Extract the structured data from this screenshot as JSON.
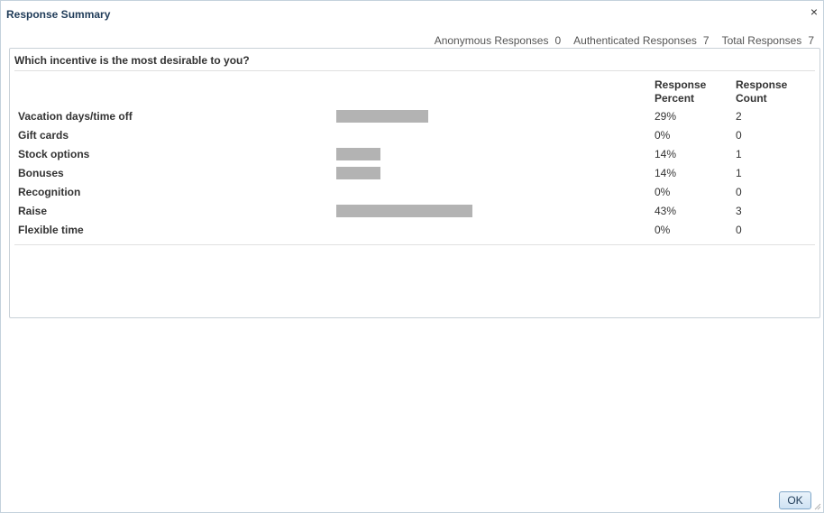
{
  "dialog": {
    "title": "Response Summary",
    "close_glyph": "×",
    "ok_label": "OK",
    "accent_color": "#1f3b58",
    "bar_color": "#b3b3b3"
  },
  "totals": {
    "anonymous_label": "Anonymous Responses",
    "anonymous_value": "0",
    "authenticated_label": "Authenticated Responses",
    "authenticated_value": "7",
    "total_label": "Total Responses",
    "total_value": "7"
  },
  "question": {
    "text": "Which incentive is the most desirable to you?",
    "headers": {
      "percent_line1": "Response",
      "percent_line2": "Percent",
      "count_line1": "Response",
      "count_line2": "Count"
    },
    "rows": [
      {
        "label": "Vacation days/time off",
        "percent": "29%",
        "count": "2",
        "fraction": 0.29
      },
      {
        "label": "Gift cards",
        "percent": "0%",
        "count": "0",
        "fraction": 0
      },
      {
        "label": "Stock options",
        "percent": "14%",
        "count": "1",
        "fraction": 0.14
      },
      {
        "label": "Bonuses",
        "percent": "14%",
        "count": "1",
        "fraction": 0.14
      },
      {
        "label": "Recognition",
        "percent": "0%",
        "count": "0",
        "fraction": 0
      },
      {
        "label": "Raise",
        "percent": "43%",
        "count": "3",
        "fraction": 0.43
      },
      {
        "label": "Flexible time",
        "percent": "0%",
        "count": "0",
        "fraction": 0
      }
    ]
  }
}
